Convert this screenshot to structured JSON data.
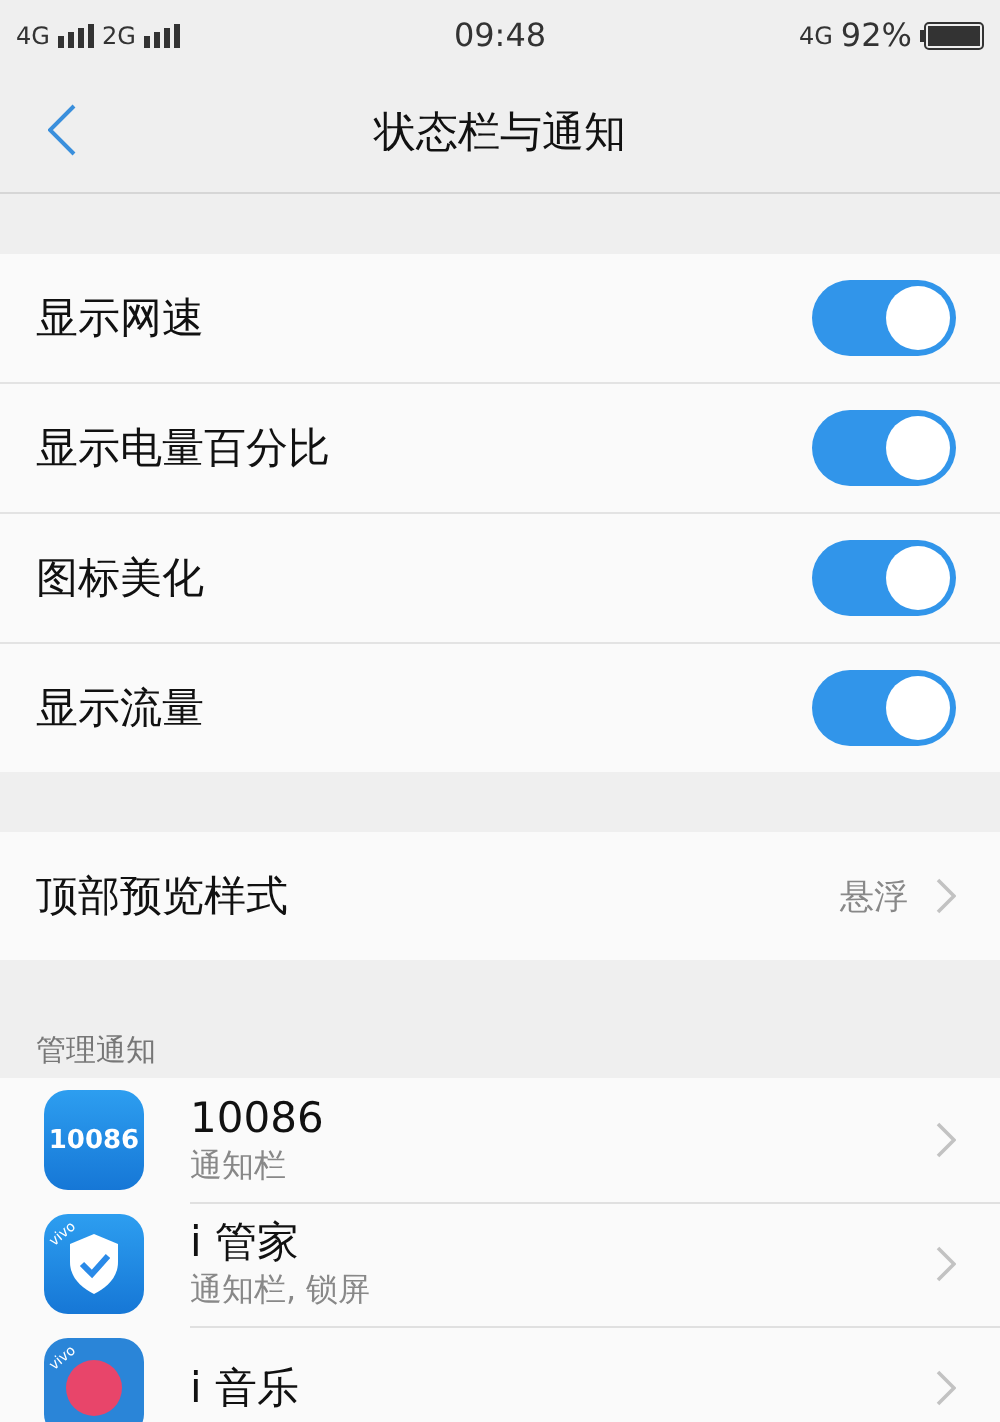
{
  "status_bar": {
    "left": [
      "4G",
      "2G"
    ],
    "time": "09:48",
    "network": "4G",
    "battery": "92%"
  },
  "header": {
    "title": "状态栏与通知"
  },
  "toggles": [
    {
      "label": "显示网速",
      "on": true
    },
    {
      "label": "显示电量百分比",
      "on": true
    },
    {
      "label": "图标美化",
      "on": true
    },
    {
      "label": "显示流量",
      "on": true
    }
  ],
  "preview": {
    "label": "顶部预览样式",
    "value": "悬浮"
  },
  "section_title": "管理通知",
  "apps": [
    {
      "kind": "number",
      "icon_text": "10086",
      "name": "10086",
      "detail": "通知栏"
    },
    {
      "kind": "shield",
      "icon_text": "vivo",
      "name": "i 管家",
      "detail": "通知栏, 锁屏"
    },
    {
      "kind": "music",
      "icon_text": "vivo",
      "name": "i 音乐"
    }
  ]
}
